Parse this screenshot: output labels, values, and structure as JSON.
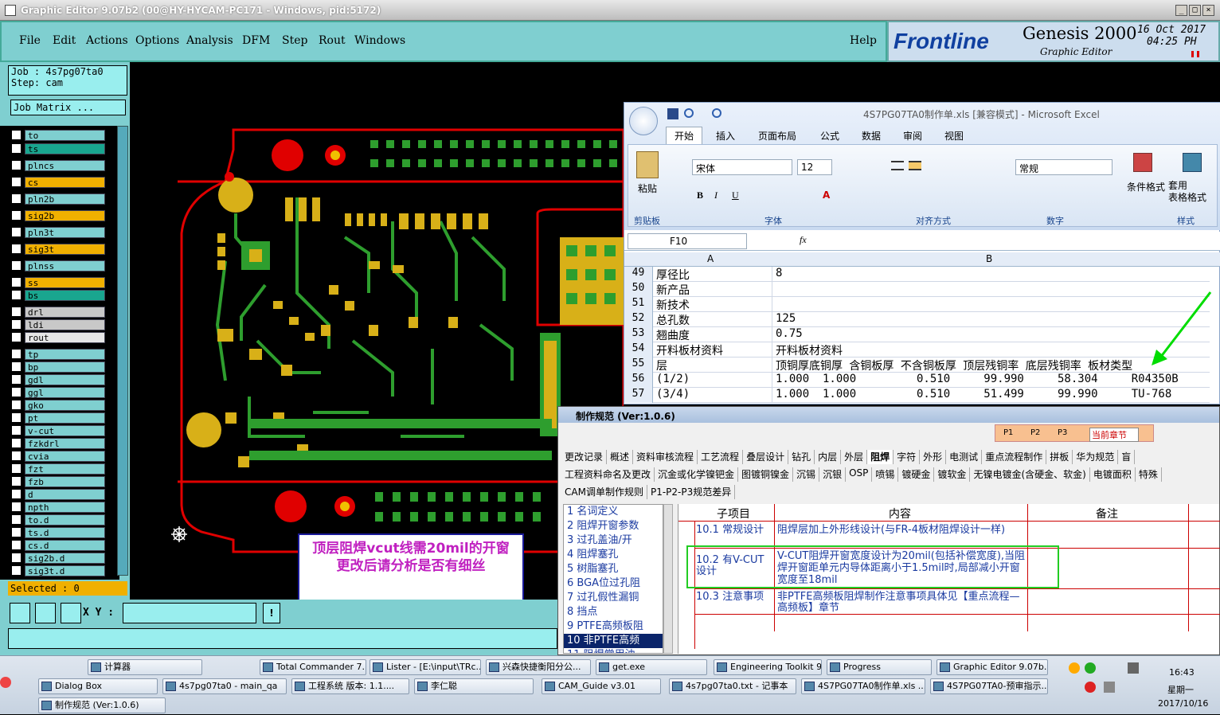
{
  "titlebar": {
    "title": "Graphic Editor 9.07b2 (00@HY-HYCAM-PC171 - Windows, pid:5172)"
  },
  "menubar": {
    "items": [
      "File",
      "Edit",
      "Actions",
      "Options",
      "Analysis",
      "DFM",
      "Step",
      "Rout",
      "Windows"
    ],
    "help": "Help"
  },
  "logo": {
    "brand": "Frontline",
    "product": "Genesis 2000",
    "subtitle": "Graphic Editor",
    "date": "16 Oct 2017",
    "time": "04:25 PH"
  },
  "left": {
    "job": "Job : 4s7pg07ta0",
    "step": "Step: cam",
    "job_matrix": "Job Matrix ...",
    "selected": "Selected : 0",
    "layers": [
      {
        "name": "to",
        "color": "#7fcfd0"
      },
      {
        "name": "ts",
        "color": "#19a68f"
      },
      {
        "name": "plncs",
        "color": "#7fcfd0"
      },
      {
        "name": "cs",
        "color": "#f0b000"
      },
      {
        "name": "pln2b",
        "color": "#7fcfd0"
      },
      {
        "name": "sig2b",
        "color": "#f0b000"
      },
      {
        "name": "pln3t",
        "color": "#7fcfd0"
      },
      {
        "name": "sig3t",
        "color": "#f0b000"
      },
      {
        "name": "plnss",
        "color": "#7fcfd0"
      },
      {
        "name": "ss",
        "color": "#f0b000"
      },
      {
        "name": "bs",
        "color": "#19a68f"
      },
      {
        "name": "drl",
        "color": "#c8c8c8"
      },
      {
        "name": "ldi",
        "color": "#c8c8c8"
      },
      {
        "name": "rout",
        "color": "#e6e6e6"
      },
      {
        "name": "tp",
        "color": "#7fcfd0"
      },
      {
        "name": "bp",
        "color": "#7fcfd0"
      },
      {
        "name": "gdl",
        "color": "#7fcfd0"
      },
      {
        "name": "ggl",
        "color": "#7fcfd0"
      },
      {
        "name": "gko",
        "color": "#7fcfd0"
      },
      {
        "name": "pt",
        "color": "#7fcfd0"
      },
      {
        "name": "v-cut",
        "color": "#7fcfd0"
      },
      {
        "name": "fzkdrl",
        "color": "#7fcfd0"
      },
      {
        "name": "cvia",
        "color": "#7fcfd0"
      },
      {
        "name": "fzt",
        "color": "#7fcfd0"
      },
      {
        "name": "fzb",
        "color": "#7fcfd0"
      },
      {
        "name": "d",
        "color": "#7fcfd0"
      },
      {
        "name": "npth",
        "color": "#7fcfd0"
      },
      {
        "name": "to.d",
        "color": "#7fcfd0"
      },
      {
        "name": "ts.d",
        "color": "#7fcfd0"
      },
      {
        "name": "cs.d",
        "color": "#7fcfd0"
      },
      {
        "name": "sig2b.d",
        "color": "#7fcfd0"
      },
      {
        "name": "sig3t.d",
        "color": "#7fcfd0"
      }
    ]
  },
  "bottombar": {
    "xy_label": "X Y :",
    "xy_value": ""
  },
  "note": {
    "text": "顶层阻焊vcut线需20mil的开窗    更改后请分析是否有细丝"
  },
  "excel": {
    "title": "4S7PG07TA0制作单.xls  [兼容模式] - Microsoft Excel",
    "tabs": [
      "开始",
      "插入",
      "页面布局",
      "公式",
      "数据",
      "审阅",
      "视图"
    ],
    "groups": [
      "剪贴板",
      "字体",
      "对齐方式",
      "数字",
      "样式"
    ],
    "font_name": "宋体",
    "font_size": "12",
    "number_format": "常规",
    "paste": "粘贴",
    "cond_format": "条件格式",
    "table_format": "套用\n表格格式",
    "cell_ref": "F10",
    "col_a": "A",
    "col_b": "B",
    "rows": [
      {
        "n": "49",
        "a": "厚径比",
        "b": "8"
      },
      {
        "n": "50",
        "a": "新产品",
        "b": ""
      },
      {
        "n": "51",
        "a": "新技术",
        "b": ""
      },
      {
        "n": "52",
        "a": "总孔数",
        "b": "125"
      },
      {
        "n": "53",
        "a": "翘曲度",
        "b": "0.75"
      },
      {
        "n": "54",
        "a": "开料板材资料",
        "b": "开料板材资料"
      },
      {
        "n": "55",
        "a": "层",
        "b": "顶铜厚底铜厚 含铜板厚 不含铜板厚 顶层残铜率 底层残铜率 板材类型"
      },
      {
        "n": "56",
        "a": "(1/2)",
        "b": "1.000  1.000         0.510     99.990     58.304     R04350B"
      },
      {
        "n": "57",
        "a": "(3/4)",
        "b": "1.000  1.000         0.510     51.499     99.990     TU-768"
      }
    ]
  },
  "spec": {
    "title": "制作规范 (Ver:1.0.6)",
    "options": [
      "P1",
      "P2",
      "P3"
    ],
    "chapter": "当前章节",
    "tabs1": [
      "更改记录",
      "概述",
      "资料审核流程",
      "工艺流程",
      "叠层设计",
      "钻孔",
      "内层",
      "外层",
      "阻焊",
      "字符",
      "外形",
      "电测试",
      "重点流程制作",
      "拼板",
      "华为规范",
      "盲"
    ],
    "tabs2": [
      "工程资料命名及更改",
      "沉金或化学镍钯金",
      "图镀铜镍金",
      "沉锡",
      "沉银",
      "OSP",
      "喷锡",
      "镀硬金",
      "镀软金",
      "无镍电镀金(含硬金、软金)",
      "电镀面积",
      "特殊"
    ],
    "tabs3": [
      "CAM调单制作规则",
      "P1-P2-P3规范差异"
    ],
    "tree": [
      "1 名词定义",
      "2 阻焊开窗参数",
      "3 过孔盖油/开",
      "4 阻焊塞孔",
      "5 树脂塞孔",
      "6 BGA位过孔阻",
      "7 过孔假性漏铜",
      "8 挡点",
      "9 PTFE高频板阻",
      "10 非PTFE高频",
      "11 阻焊常用油"
    ],
    "headers": [
      "子项目",
      "内容",
      "备注"
    ],
    "items": [
      {
        "sub": "10.1 常规设计",
        "content": "阻焊层加上外形线设计(与FR-4板材阻焊设计一样)"
      },
      {
        "sub": "10.2 有V-CUT设计",
        "content": "V-CUT阻焊开窗宽度设计为20mil(包括补偿宽度),当阻焊开窗距单元内导体距离小于1.5mil时,局部减小开窗宽度至18mil"
      },
      {
        "sub": "10.3 注意事项",
        "content": "非PTFE高频板阻焊制作注意事项具体见【重点流程—高频板】章节"
      }
    ]
  },
  "taskbar": {
    "row1": [
      "计算器",
      "Total Commander 7....",
      "Lister - [E:\\input\\TRc...",
      "兴森快捷衡阳分公...",
      "get.exe",
      "Engineering Toolkit 9...",
      "Progress",
      "Graphic Editor 9.07b..."
    ],
    "row2": [
      "Dialog Box",
      "4s7pg07ta0 - main_qa",
      "工程系统 版本: 1.1....",
      "李仁聪",
      "CAM_Guide v3.01",
      "4s7pg07ta0.txt - 记事本",
      "4S7PG07TA0制作单.xls ...",
      "4S7PG07TA0-预审指示..."
    ],
    "row3": [
      "制作规范 (Ver:1.0.6)"
    ],
    "clock": "16:43",
    "weekday": "星期一",
    "date": "2017/10/16"
  },
  "colors": {
    "pcb_green": "#2e9e2e",
    "pcb_red": "#e00000",
    "pad_yellow": "#d8b018",
    "cyan": "#7fcfd0"
  }
}
